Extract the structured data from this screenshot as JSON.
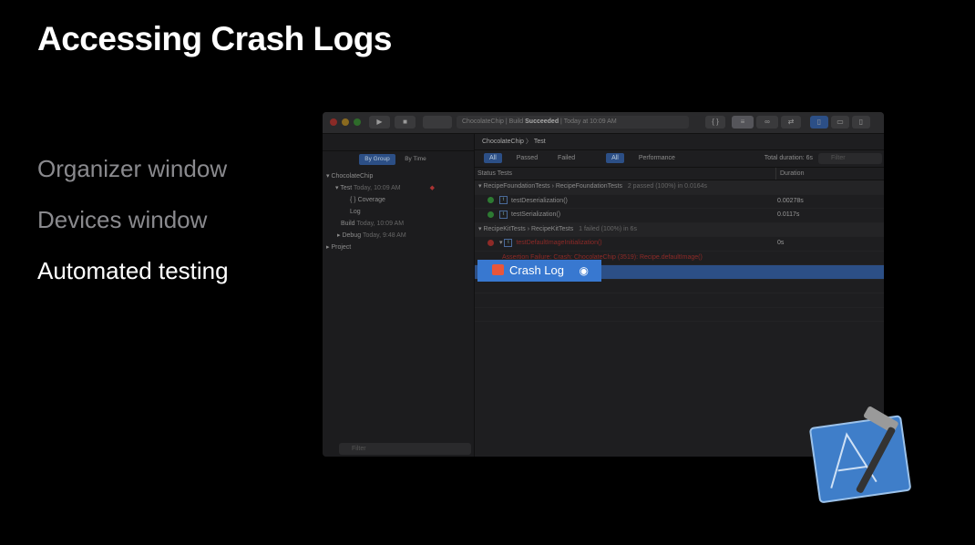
{
  "slide": {
    "title": "Accessing Crash Logs",
    "bullets": [
      "Organizer window",
      "Devices window",
      "Automated testing"
    ]
  },
  "xcode": {
    "toolbar": {
      "scheme": "ChocolateChip",
      "status_prefix": "ChocolateChip | Build ",
      "status_bold": "Succeeded",
      "status_suffix": " | Today at 10:09 AM"
    },
    "navigator": {
      "segments": [
        "By Group",
        "By Time"
      ],
      "tree": [
        {
          "label": "ChocolateChip",
          "sub": ""
        },
        {
          "label": "Test",
          "sub": "Today, 10:09 AM"
        },
        {
          "label": "{ } Coverage",
          "sub": ""
        },
        {
          "label": "Log",
          "sub": ""
        },
        {
          "label": "Build",
          "sub": "Today, 10:09 AM"
        },
        {
          "label": "Debug",
          "sub": "Today, 9:48 AM"
        },
        {
          "label": "Project",
          "sub": ""
        }
      ],
      "filter_placeholder": "Filter"
    },
    "jumpbar": {
      "project": "ChocolateChip",
      "item": "Test"
    },
    "filters": {
      "chips": [
        "All",
        "Passed",
        "Failed"
      ],
      "chips2": [
        "All",
        "Performance"
      ],
      "total": "Total duration: 6s",
      "filter_placeholder": "Filter"
    },
    "columns": {
      "status": "Status",
      "tests": "Tests",
      "duration": "Duration"
    },
    "group1": {
      "label": "RecipeFoundationTests › RecipeFoundationTests",
      "summary": "2 passed (100%) in 0.0164s"
    },
    "tests1": [
      {
        "name": "testDeserialization()",
        "duration": "0.00278s"
      },
      {
        "name": "testSerialization()",
        "duration": "0.0117s"
      }
    ],
    "group2": {
      "label": "RecipeKitTests › RecipeKitTests",
      "summary": "1 failed (100%) in 6s"
    },
    "failed_test": {
      "name": "testDefaultImageInitialization()",
      "duration": "0s"
    },
    "failure_detail": "Assertion Failure: Crash: ChocolateChip (3519): Recipe.defaultImage()",
    "popup": {
      "label": "Crash Log"
    }
  }
}
